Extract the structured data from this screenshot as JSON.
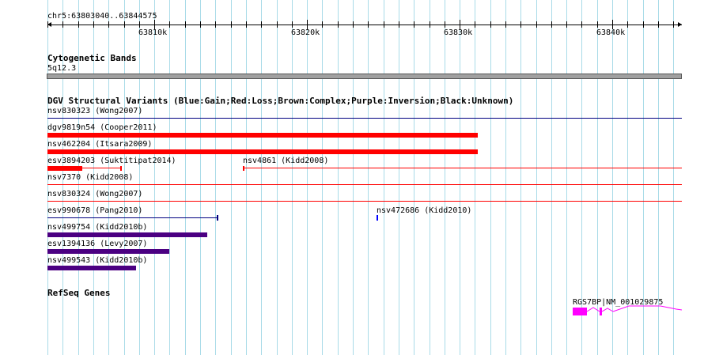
{
  "ruler": {
    "coordinates": "chr5:63803040..63844575",
    "ticks": [
      "63810k",
      "63820k",
      "63830k",
      "63840k"
    ]
  },
  "tracks": {
    "cytoband": {
      "title": "Cytogenetic Bands",
      "band_label": "5q12.3"
    },
    "dgv": {
      "title": "DGV Structural Variants (Blue:Gain;Red:Loss;Brown:Complex;Purple:Inversion;Black:Unknown)",
      "features": [
        {
          "label": "nsv830323 (Wong2007)",
          "color": "#000080"
        },
        {
          "label": "dgv9819n54 (Cooper2011)",
          "color": "#ff0000"
        },
        {
          "label": "nsv462204 (Itsara2009)",
          "color": "#ff0000"
        },
        {
          "label": "esv3894203 (Suktitipat2014)",
          "color": "#ff0000"
        },
        {
          "label": "nsv4861 (Kidd2008)",
          "color": "#ff0000"
        },
        {
          "label": "nsv7370 (Kidd2008)",
          "color": "#ff0000"
        },
        {
          "label": "nsv830324 (Wong2007)",
          "color": "#ff0000"
        },
        {
          "label": "esv990678 (Pang2010)",
          "color": "#000080"
        },
        {
          "label": "nsv472686 (Kidd2010)",
          "color": "#0000ff"
        },
        {
          "label": "nsv499754 (Kidd2010b)",
          "color": "#4b0082"
        },
        {
          "label": "esv1394136 (Levy2007)",
          "color": "#4b0082"
        },
        {
          "label": "nsv499543 (Kidd2010b)",
          "color": "#4b0082"
        }
      ]
    },
    "refseq": {
      "title": "RefSeq Genes",
      "gene_label": "RGS7BP|NM_001029875",
      "color": "#ff00ff"
    }
  }
}
